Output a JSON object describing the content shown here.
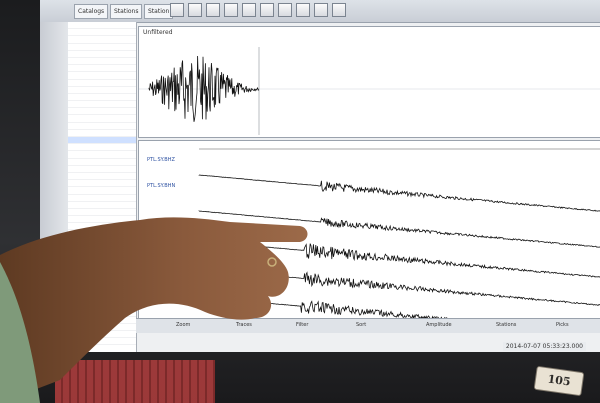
{
  "toolbar": {
    "tabs": [
      "Catalogs",
      "Stations",
      "Station"
    ],
    "button_icons": [
      "open-file-icon",
      "save-icon",
      "zoom-in-icon",
      "zoom-out-icon",
      "filter-icon",
      "pick-icon",
      "play-icon",
      "stop-icon",
      "refresh-icon",
      "settings-icon"
    ]
  },
  "top_panel": {
    "title": "Unfiltered"
  },
  "traces": [
    {
      "label": "PTL.SY.BHZ"
    },
    {
      "label": "PTL.SY.BHN"
    },
    {
      "label": ""
    },
    {
      "label": ""
    },
    {
      "label": ""
    }
  ],
  "status": {
    "items": [
      "Zoom",
      "Traces",
      "Filter",
      "Sort",
      "Amplitude",
      "Stations",
      "Picks"
    ],
    "timestamp": "2014-07-07 05:33:23.000"
  },
  "sticker": {
    "text": "105"
  },
  "colors": {
    "screen": "#eef0f2",
    "trace": "#111111",
    "skin": "#8a5a3c"
  }
}
